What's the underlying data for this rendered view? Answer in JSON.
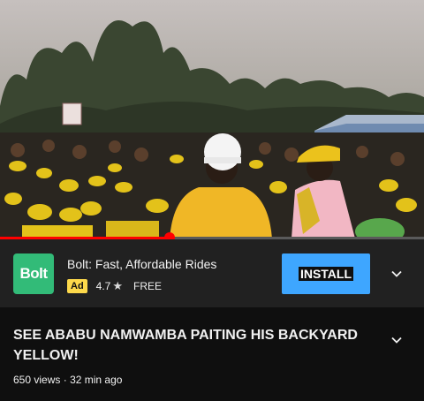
{
  "video": {
    "progress_fraction": 0.4
  },
  "ad": {
    "logo_text": "Bolt",
    "title": "Bolt: Fast, Affordable Rides",
    "badge": "Ad",
    "rating": "4.7",
    "price": "FREE",
    "install_label": "INSTALL",
    "colors": {
      "logo_bg": "#32bb78",
      "install_bg": "#3ea6ff",
      "badge_bg": "#fdd94b"
    }
  },
  "video_info": {
    "title": "SEE ABABU NAMWAMBA PAITING HIS BACKYARD YELLOW!",
    "views": "650 views",
    "separator": "·",
    "age": "32 min ago"
  },
  "icons": {
    "star": "star-icon",
    "chevron": "chevron-down-icon"
  }
}
